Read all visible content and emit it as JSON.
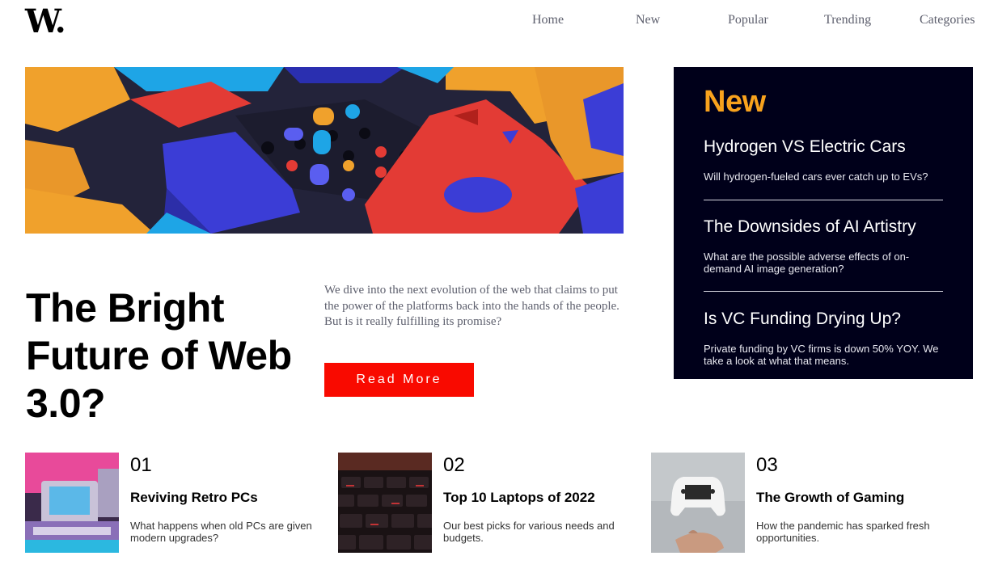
{
  "header": {
    "logo": "W.",
    "nav": [
      "Home",
      "New",
      "Popular",
      "Trending",
      "Categories"
    ]
  },
  "hero": {
    "title": "The Bright Future of Web 3.0?",
    "description": "We dive into the next evolution of the web that claims to put the power of the platforms back into the hands of the people. But is it really fulfilling its promise?",
    "button_label": "Read More"
  },
  "new_panel": {
    "heading": "New",
    "items": [
      {
        "title": "Hydrogen VS Electric Cars",
        "description": "Will hydrogen-fueled cars ever catch up to EVs?"
      },
      {
        "title": "The Downsides of AI Artistry",
        "description": "What are the possible adverse effects of on-demand AI image generation?"
      },
      {
        "title": "Is VC Funding Drying Up?",
        "description": "Private funding by VC firms is down 50% YOY. We take a look at what that means."
      }
    ]
  },
  "articles": [
    {
      "number": "01",
      "title": "Reviving Retro PCs",
      "description": "What happens when old PCs are given modern upgrades?"
    },
    {
      "number": "02",
      "title": "Top 10 Laptops of 2022",
      "description": "Our best picks for various needs and budgets."
    },
    {
      "number": "03",
      "title": "The Growth of Gaming",
      "description": "How the pandemic has sparked fresh opportunities."
    }
  ],
  "colors": {
    "accent_orange": "#f8a21d",
    "accent_red": "#f90a00",
    "panel_bg": "#00001a",
    "text_grey": "#5d5f6d"
  }
}
